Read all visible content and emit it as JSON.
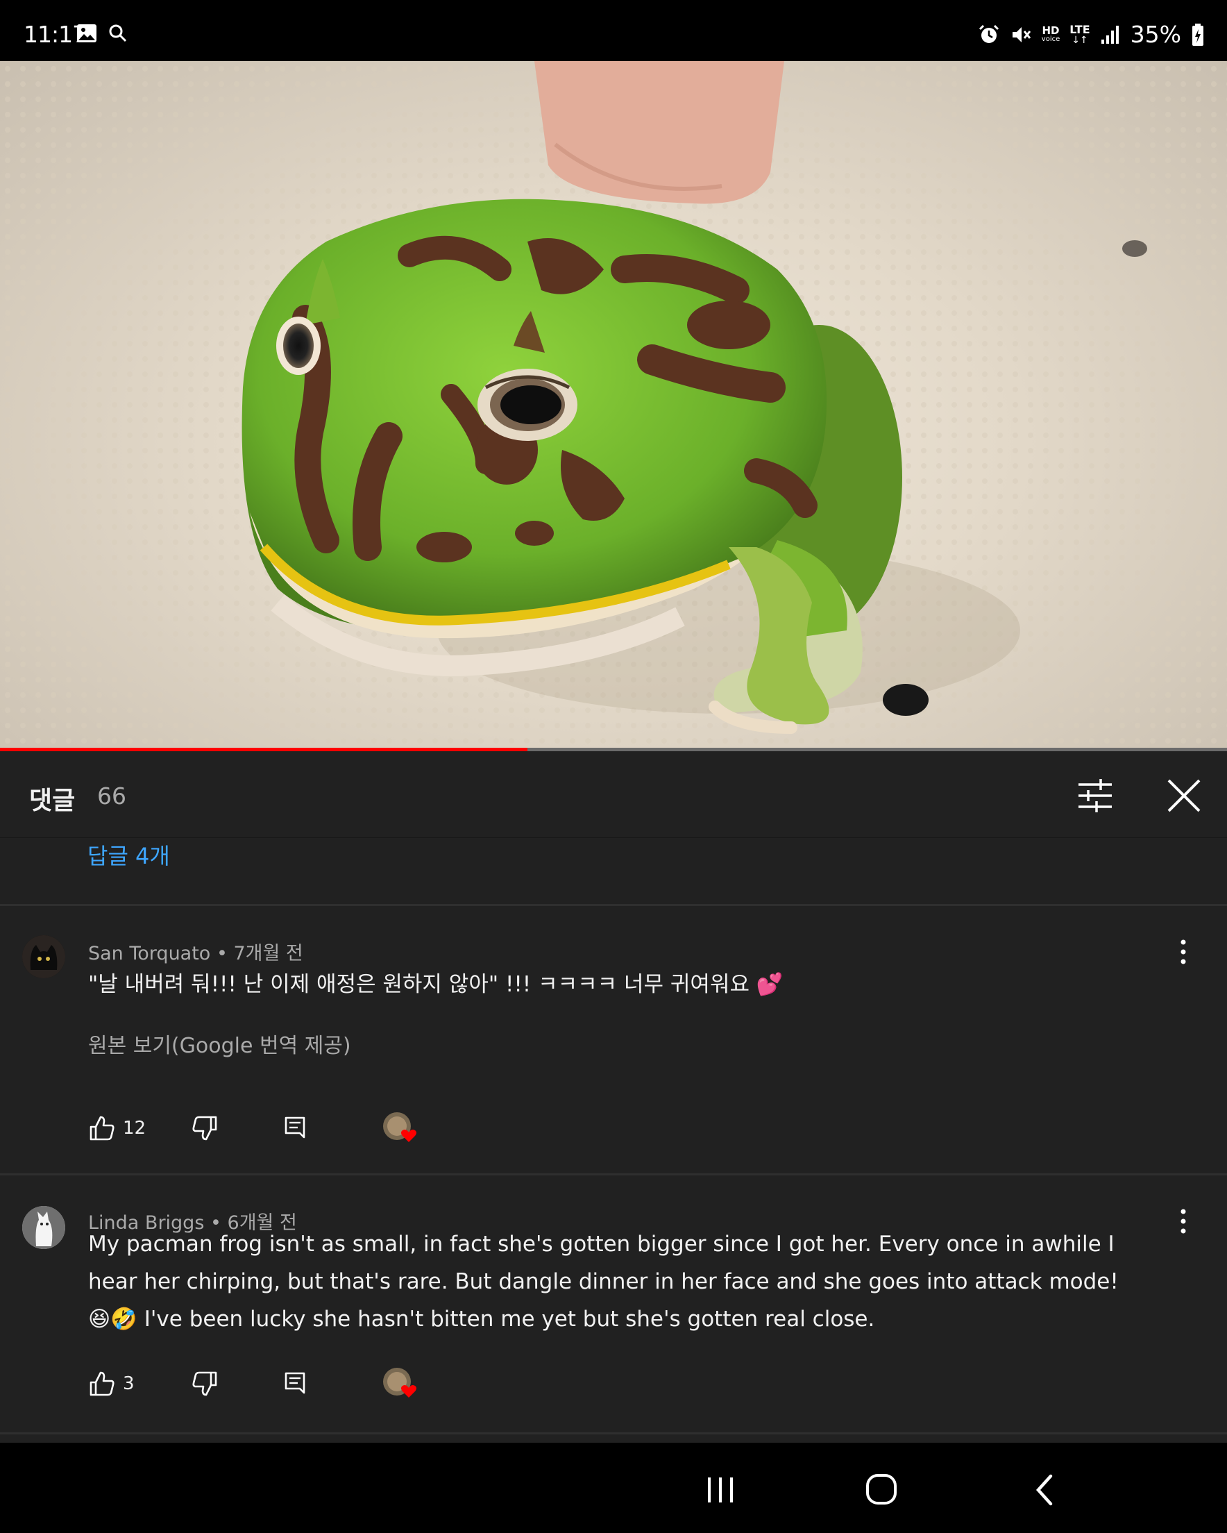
{
  "status_bar": {
    "time": "11:17",
    "battery": "35%",
    "hd_label": "HD",
    "hd_sub": "voice",
    "lte_label": "LTE"
  },
  "video": {
    "progress": 0.43
  },
  "comments": {
    "title": "댓글",
    "count": "66",
    "replies_link": "답글 4개",
    "items": [
      {
        "author": "San Torquato",
        "time": "7개월 전",
        "text": "\"날 내버려 둬!!! 난 이제 애정은 원하지 않아\" !!! ㅋㅋㅋㅋ 너무 귀여워요 💕",
        "translate": "원본 보기(Google 번역 제공)",
        "likes": "12"
      },
      {
        "author": "Linda Briggs",
        "time": "6개월 전",
        "text": "My pacman frog isn't as small, in fact she's gotten bigger since I got her.  Every once in awhile I hear her chirping, but that's rare.  But dangle dinner in her face and she goes into attack mode!  😆🤣  I've been lucky she hasn't bitten me yet but she's gotten real close.",
        "likes": "3"
      }
    ]
  },
  "colors": {
    "background": "#212121",
    "accent_link": "#3ea6ff",
    "progress": "#ff0000",
    "heart": "#ff0000"
  },
  "icons": [
    "gallery-icon",
    "search-icon",
    "alarm-icon",
    "mute-icon",
    "signal-icon",
    "battery-icon",
    "filter-icon",
    "close-icon",
    "like-icon",
    "dislike-icon",
    "reply-icon",
    "more-icon",
    "recents-icon",
    "home-icon",
    "back-icon"
  ]
}
